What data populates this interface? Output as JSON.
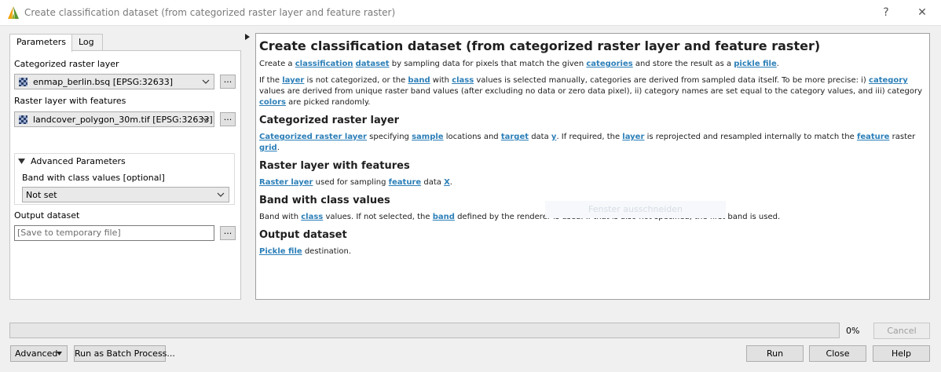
{
  "window": {
    "title": "Create classification dataset (from categorized raster layer and feature raster)",
    "help_btn": "?",
    "close_btn": "✕"
  },
  "tabs": [
    "Parameters",
    "Log"
  ],
  "params": {
    "categorized_label": "Categorized raster layer",
    "categorized_value": "enmap_berlin.bsq [EPSG:32633]",
    "features_label": "Raster layer with features",
    "features_value": "landcover_polygon_30m.tif [EPSG:32633]",
    "browse": "...",
    "advanced_label": "Advanced Parameters",
    "band_label": "Band with class values [optional]",
    "band_value": "Not set",
    "output_label": "Output dataset",
    "output_placeholder": "[Save to temporary file]",
    "output_browse": "..."
  },
  "help": {
    "title": "Create classification dataset (from categorized raster layer and feature raster)",
    "intro": [
      {
        "t": "Create a "
      },
      {
        "a": "classification"
      },
      {
        "t": " "
      },
      {
        "a": "dataset"
      },
      {
        "t": " by sampling data for pixels that match the given "
      },
      {
        "a": "categories"
      },
      {
        "t": " and store the result as a "
      },
      {
        "a": "pickle file"
      },
      {
        "t": "."
      }
    ],
    "details": [
      {
        "t": "If the "
      },
      {
        "a": "layer"
      },
      {
        "t": " is not categorized, or the "
      },
      {
        "a": "band"
      },
      {
        "t": " with "
      },
      {
        "a": "class"
      },
      {
        "t": " values is selected manually, categories are derived from sampled data itself. To be more precise: i) "
      },
      {
        "a": "category"
      },
      {
        "t": " values are derived from unique raster band values (after excluding no data or zero data pixel), ii) category names are set equal to the category values, and iii) category "
      },
      {
        "a": "colors"
      },
      {
        "t": " are picked randomly."
      }
    ],
    "sections": [
      {
        "heading": "Categorized raster layer",
        "parts": [
          {
            "a": "Categorized raster layer"
          },
          {
            "t": " specifying "
          },
          {
            "a": "sample"
          },
          {
            "t": " locations and "
          },
          {
            "a": "target"
          },
          {
            "t": " data "
          },
          {
            "a": "y"
          },
          {
            "t": ". If required, the "
          },
          {
            "a": "layer"
          },
          {
            "t": " is reprojected and resampled internally to match the "
          },
          {
            "a": "feature"
          },
          {
            "t": " raster "
          },
          {
            "a": "grid"
          },
          {
            "t": "."
          }
        ]
      },
      {
        "heading": "Raster layer with features",
        "parts": [
          {
            "a": "Raster layer"
          },
          {
            "t": " used for sampling "
          },
          {
            "a": "feature"
          },
          {
            "t": " data "
          },
          {
            "a": "X"
          },
          {
            "t": "."
          }
        ]
      },
      {
        "heading": "Band with class values",
        "parts": [
          {
            "t": "Band with "
          },
          {
            "a": "class"
          },
          {
            "t": " values. If not selected, the "
          },
          {
            "a": "band"
          },
          {
            "t": " defined by the renderer is used. If that is also not specified, the first band is used."
          }
        ]
      },
      {
        "heading": "Output dataset",
        "parts": [
          {
            "a": "Pickle file"
          },
          {
            "t": " destination."
          }
        ]
      }
    ],
    "ghost_tooltip": "Fenster ausschneiden"
  },
  "progress": {
    "value": 0,
    "label": "0%"
  },
  "buttons": {
    "cancel": "Cancel",
    "advanced": "Advanced",
    "batch": "Run as Batch Process...",
    "run": "Run",
    "close": "Close",
    "help": "Help"
  },
  "colors": {
    "link": "#2c7fb8",
    "progress": "#06b025"
  },
  "icons": [
    "qgis-logo-icon",
    "raster-layer-icon",
    "chevron-down-icon",
    "triangle-down-icon",
    "triangle-right-icon",
    "help-icon",
    "close-icon"
  ]
}
